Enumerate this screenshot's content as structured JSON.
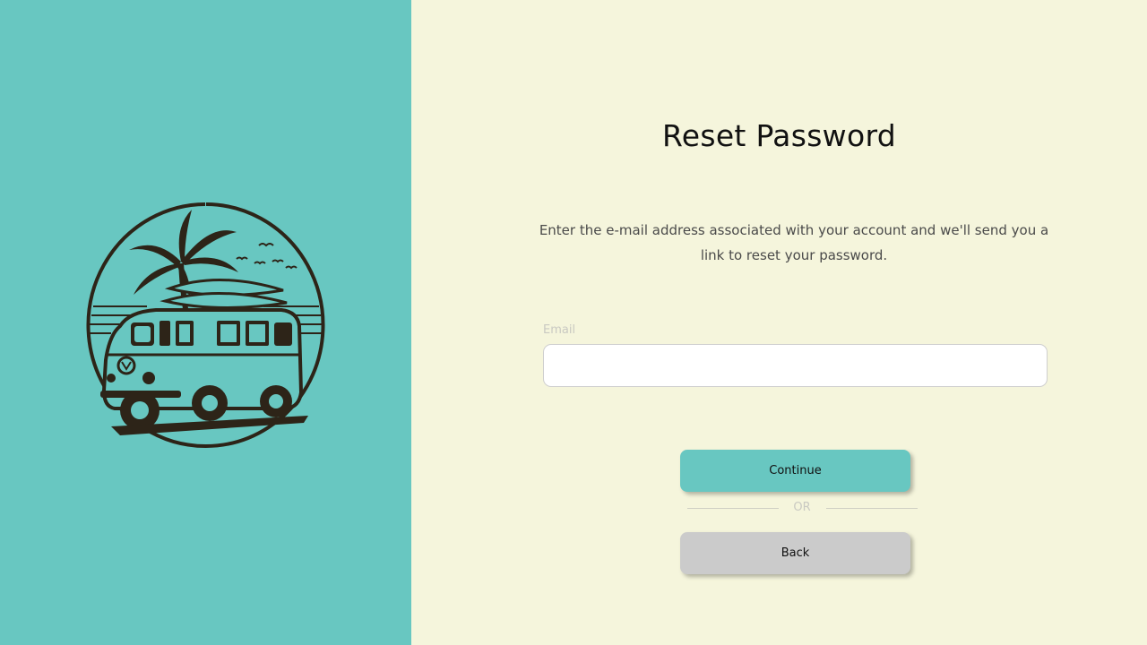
{
  "colors": {
    "left_panel_bg": "#68c7c1",
    "right_panel_bg": "#f5f5dc",
    "continue_button_bg": "#68c7c1",
    "back_button_bg": "#cbcbcb",
    "logo_ink": "#2d2418"
  },
  "logo": {
    "icon": "surf-van-palm-logo"
  },
  "form": {
    "title": "Reset Password",
    "description": "Enter the e-mail address associated with your account and we'll send you a link to reset your password.",
    "email_label": "Email",
    "email_value": "",
    "email_placeholder": "",
    "continue_label": "Continue",
    "or_text": "OR",
    "back_label": "Back"
  }
}
